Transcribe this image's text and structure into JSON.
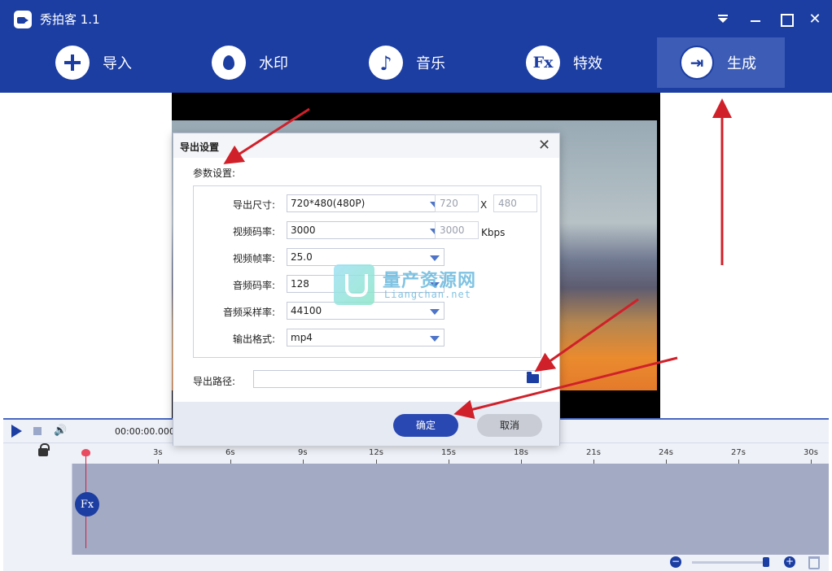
{
  "app": {
    "title": "秀拍客 1.1"
  },
  "nav": {
    "import": "导入",
    "watermark": "水印",
    "music": "音乐",
    "effects": "特效",
    "effects_icon_text": "Fx",
    "generate": "生成"
  },
  "dialog": {
    "title": "导出设置",
    "section": "参数设置:",
    "rows": {
      "size_label": "导出尺寸:",
      "size_value": "720*480(480P)",
      "width_value": "720",
      "height_value": "480",
      "x_sep": "X",
      "vbitrate_label": "视频码率:",
      "vbitrate_value": "3000",
      "vbitrate_readonly": "3000",
      "vbitrate_unit": "Kbps",
      "fps_label": "视频帧率:",
      "fps_value": "25.0",
      "abitrate_label": "音频码率:",
      "abitrate_value": "128",
      "samplerate_label": "音频采样率:",
      "samplerate_value": "44100",
      "format_label": "输出格式:",
      "format_value": "mp4"
    },
    "path_label": "导出路径:",
    "path_value": "",
    "ok": "确定",
    "cancel": "取消"
  },
  "timeline": {
    "timecode": "00:00:00.000",
    "ticks": [
      "3s",
      "6s",
      "9s",
      "12s",
      "15s",
      "18s",
      "21s",
      "24s",
      "27s",
      "30s"
    ],
    "fx_badge": "Fx",
    "zoom_out": "−",
    "zoom_in": "+"
  },
  "watermark": {
    "cn": "量产资源网",
    "en": "Liangchan.net"
  },
  "colors": {
    "brand": "#1c3ea3",
    "accent_button": "#2a48b2",
    "annotation_arrow": "#d0202a"
  }
}
